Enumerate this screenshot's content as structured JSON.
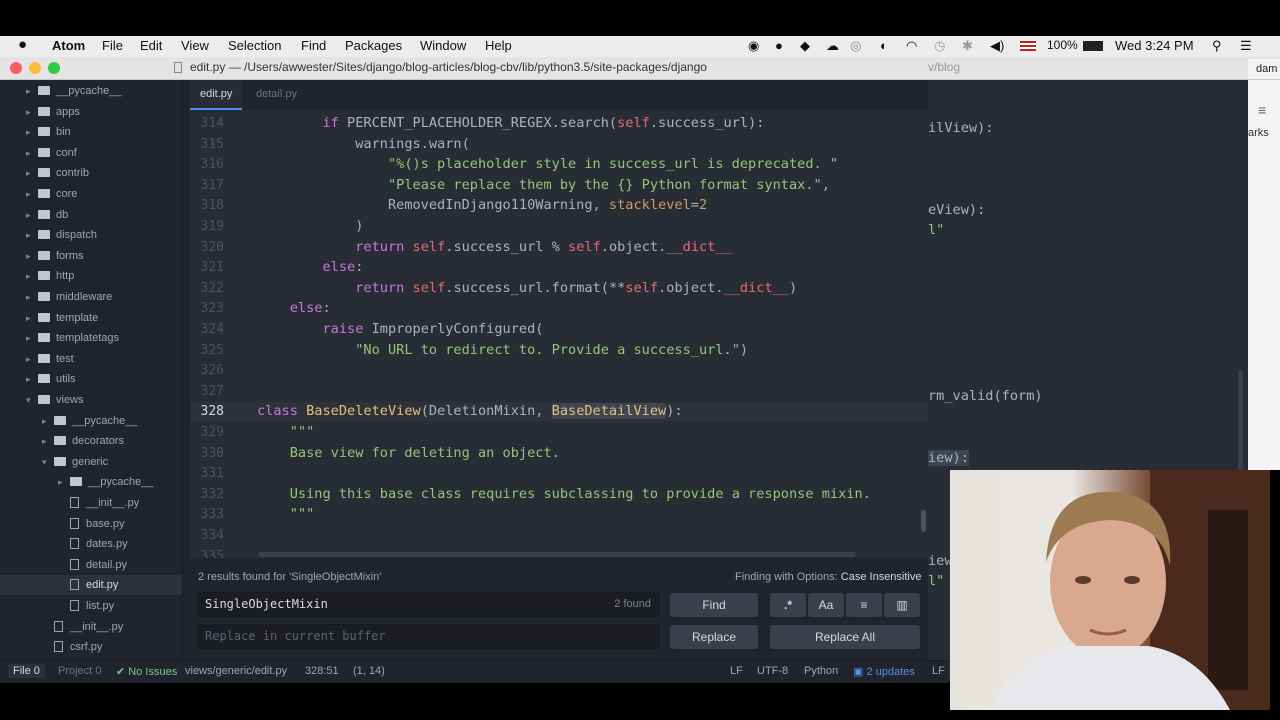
{
  "menubar": {
    "apple": "",
    "items": [
      "Atom",
      "File",
      "Edit",
      "View",
      "Selection",
      "Find",
      "Packages",
      "Window",
      "Help"
    ],
    "battery": "100%",
    "clock": "Wed 3:24 PM"
  },
  "window": {
    "title": "edit.py — /Users/awwester/Sites/django/blog-articles/blog-cbv/lib/python3.5/site-packages/django"
  },
  "tree": [
    {
      "label": "__pycache__",
      "type": "folder",
      "open": false,
      "indent": 0
    },
    {
      "label": "apps",
      "type": "folder",
      "open": false,
      "indent": 0
    },
    {
      "label": "bin",
      "type": "folder",
      "open": false,
      "indent": 0
    },
    {
      "label": "conf",
      "type": "folder",
      "open": false,
      "indent": 0
    },
    {
      "label": "contrib",
      "type": "folder",
      "open": false,
      "indent": 0
    },
    {
      "label": "core",
      "type": "folder",
      "open": false,
      "indent": 0
    },
    {
      "label": "db",
      "type": "folder",
      "open": false,
      "indent": 0
    },
    {
      "label": "dispatch",
      "type": "folder",
      "open": false,
      "indent": 0
    },
    {
      "label": "forms",
      "type": "folder",
      "open": false,
      "indent": 0
    },
    {
      "label": "http",
      "type": "folder",
      "open": false,
      "indent": 0
    },
    {
      "label": "middleware",
      "type": "folder",
      "open": false,
      "indent": 0
    },
    {
      "label": "template",
      "type": "folder",
      "open": false,
      "indent": 0
    },
    {
      "label": "templatetags",
      "type": "folder",
      "open": false,
      "indent": 0
    },
    {
      "label": "test",
      "type": "folder",
      "open": false,
      "indent": 0
    },
    {
      "label": "utils",
      "type": "folder",
      "open": false,
      "indent": 0
    },
    {
      "label": "views",
      "type": "folder",
      "open": true,
      "indent": 0
    },
    {
      "label": "__pycache__",
      "type": "folder",
      "open": false,
      "indent": 1
    },
    {
      "label": "decorators",
      "type": "folder",
      "open": false,
      "indent": 1
    },
    {
      "label": "generic",
      "type": "folder",
      "open": true,
      "indent": 1
    },
    {
      "label": "__pycache__",
      "type": "folder",
      "open": false,
      "indent": 2
    },
    {
      "label": "__init__.py",
      "type": "file",
      "indent": 2
    },
    {
      "label": "base.py",
      "type": "file",
      "indent": 2
    },
    {
      "label": "dates.py",
      "type": "file",
      "indent": 2
    },
    {
      "label": "detail.py",
      "type": "file",
      "indent": 2
    },
    {
      "label": "edit.py",
      "type": "file",
      "indent": 2,
      "selected": true
    },
    {
      "label": "list.py",
      "type": "file",
      "indent": 2
    },
    {
      "label": "__init__.py",
      "type": "file",
      "indent": 1
    },
    {
      "label": "csrf.py",
      "type": "file",
      "indent": 1
    }
  ],
  "tabs": [
    {
      "label": "edit.py",
      "active": true
    },
    {
      "label": "detail.py",
      "active": false
    }
  ],
  "code_lines": [
    {
      "n": "314",
      "cur": false,
      "t": "        <span class='kw'>if</span> PERCENT_PLACEHOLDER_REGEX.search(<span class='sf'>self</span>.success_url):"
    },
    {
      "n": "315",
      "cur": false,
      "t": "            warnings.warn("
    },
    {
      "n": "316",
      "cur": false,
      "t": "                <span class='st'>\"%()s placeholder style in success_url is deprecated. \"</span>"
    },
    {
      "n": "317",
      "cur": false,
      "t": "                <span class='st'>\"Please replace them by the {} Python format syntax.\"</span>,"
    },
    {
      "n": "318",
      "cur": false,
      "t": "                RemovedInDjango110Warning, <span class='nm'>stacklevel</span>=<span class='nm'>2</span>"
    },
    {
      "n": "319",
      "cur": false,
      "t": "            )"
    },
    {
      "n": "320",
      "cur": false,
      "t": "            <span class='kw'>return</span> <span class='sf'>self</span>.success_url % <span class='sf'>self</span>.object.<span class='sf'>__dict__</span>"
    },
    {
      "n": "321",
      "cur": false,
      "t": "        <span class='kw'>else</span>:"
    },
    {
      "n": "322",
      "cur": false,
      "t": "            <span class='kw'>return</span> <span class='sf'>self</span>.success_url.format(**<span class='sf'>self</span>.object.<span class='sf'>__dict__</span>)"
    },
    {
      "n": "323",
      "cur": false,
      "t": "    <span class='kw'>else</span>:"
    },
    {
      "n": "324",
      "cur": false,
      "t": "        <span class='kw'>raise</span> ImproperlyConfigured("
    },
    {
      "n": "325",
      "cur": false,
      "t": "            <span class='st'>\"No URL to redirect to. Provide a success_url.\"</span>)"
    },
    {
      "n": "326",
      "cur": false,
      "t": ""
    },
    {
      "n": "327",
      "cur": false,
      "t": ""
    },
    {
      "n": "328",
      "cur": true,
      "t": "<span class='kw'>class</span> <span class='fn'>BaseDeleteView</span>(DeletionMixin, <span style='background:#3e4451;color:#e5c07b'>BaseDetailView</span>):"
    },
    {
      "n": "329",
      "cur": false,
      "t": "    <span class='st'>\"\"\"</span>"
    },
    {
      "n": "330",
      "cur": false,
      "t": "    <span class='st'>Base view for deleting an object.</span>"
    },
    {
      "n": "331",
      "cur": false,
      "t": ""
    },
    {
      "n": "332",
      "cur": false,
      "t": "    <span class='st'>Using this base class requires subclassing to provide a response mixin.</span>"
    },
    {
      "n": "333",
      "cur": false,
      "t": "    <span class='st'>\"\"\"</span>"
    },
    {
      "n": "334",
      "cur": false,
      "t": ""
    },
    {
      "n": "335",
      "cur": false,
      "t": ""
    }
  ],
  "right_pane_fragments": [
    "ilView):",
    "eView):",
    "l\"",
    "rm_valid(form)",
    "iew):",
    "iew",
    "l\""
  ],
  "right_top_fragment": "v/blog",
  "right_app_fragments": [
    "dam",
    "arks"
  ],
  "find": {
    "results_text": "2 results found for 'SingleObjectMixin'",
    "options_label": "Finding with Options:",
    "options_value": "Case Insensitive",
    "query": "SingleObjectMixin",
    "count": "2 found",
    "find_button": "Find",
    "replace_placeholder": "Replace in current buffer",
    "replace_button": "Replace",
    "replace_all_button": "Replace All",
    "regex_label": ".*",
    "case_label": "Aa"
  },
  "status": {
    "file_tab": "File",
    "file_count": "0",
    "project_tab": "Project",
    "project_count": "0",
    "issues": "No Issues",
    "path": "views/generic/edit.py",
    "cursor": "328:51",
    "selection": "(1, 14)",
    "eol": "LF",
    "encoding": "UTF-8",
    "grammar": "Python",
    "updates": "2 updates",
    "eol2": "LF"
  }
}
